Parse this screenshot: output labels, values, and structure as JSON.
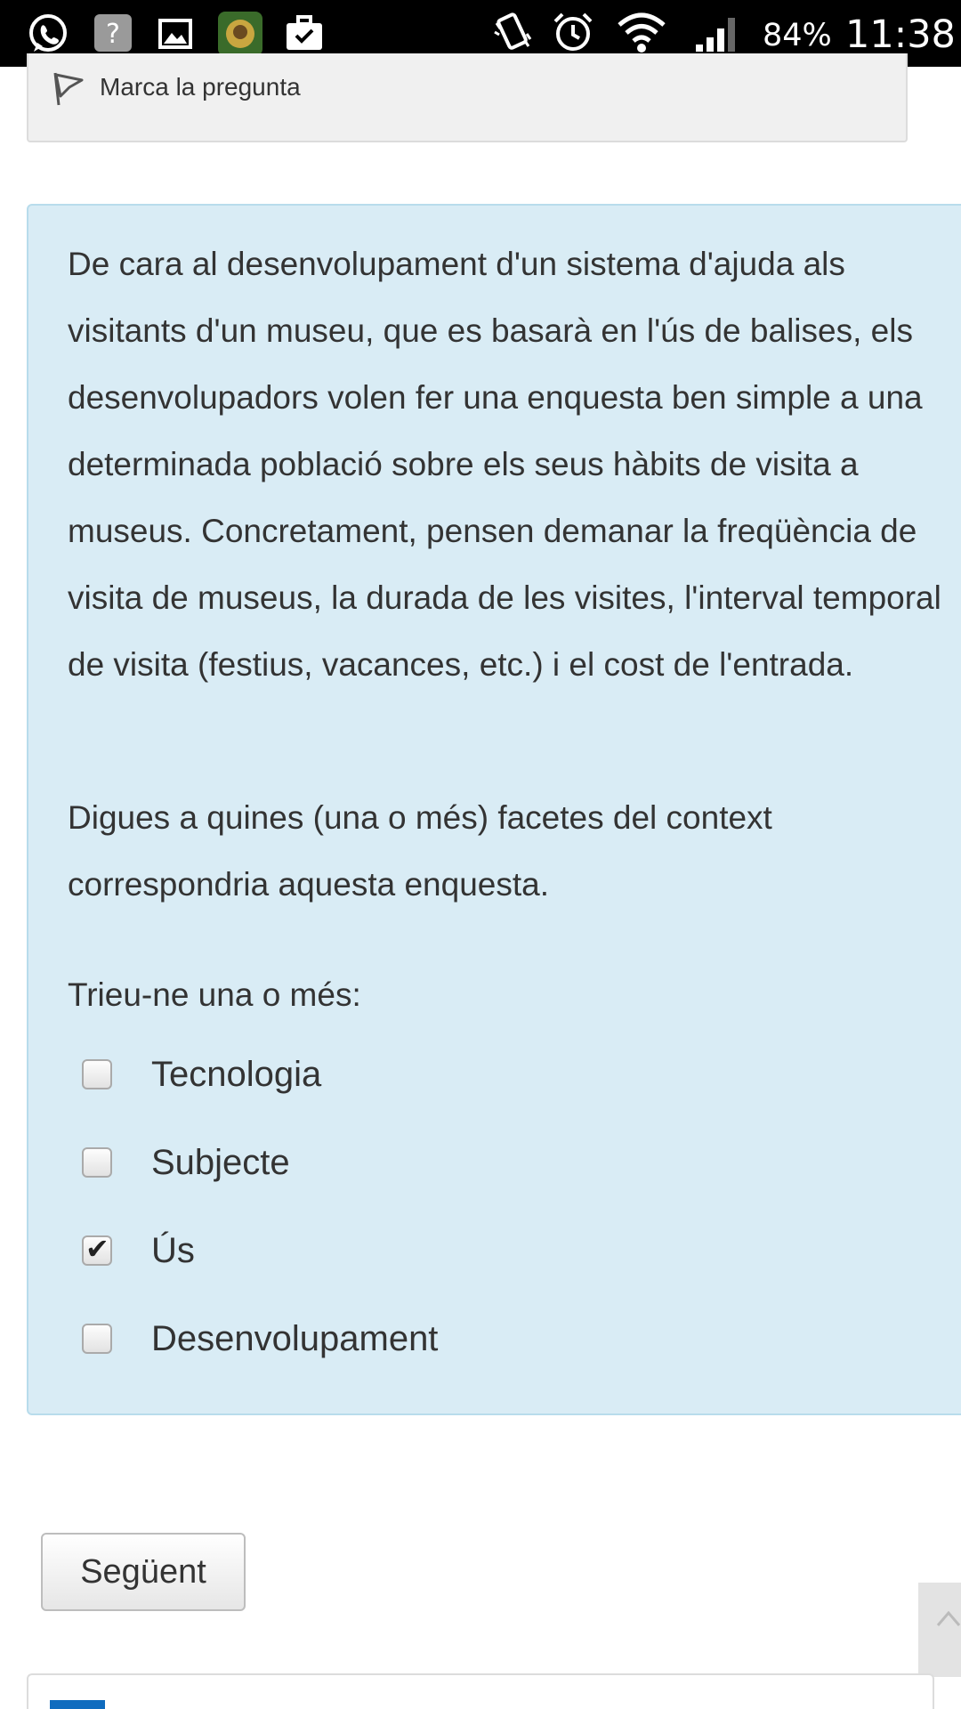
{
  "status_bar": {
    "icons": [
      "whatsapp-icon",
      "unknown-app-icon",
      "gallery-icon",
      "game-icon",
      "briefcase-check-icon",
      "vibrate-icon",
      "alarm-icon",
      "wifi-icon",
      "signal-icon"
    ],
    "battery": "84%",
    "time": "11:38"
  },
  "flag": {
    "label": "Marca la pregunta"
  },
  "question": {
    "text": "De cara al desenvolupament d'un sistema d'ajuda als visitants d'un museu, que es basarà en l'ús de balises, els desenvolupadors volen fer una enquesta ben simple a una determinada població sobre els seus hàbits de visita a museus. Concretament, pensen demanar la freqüència de visita de museus, la durada de les visites, l'interval temporal de visita (festius, vacances, etc.) i el cost de l'entrada.",
    "prompt": "Digues a quines (una o més)  facetes del context correspondria aquesta enquesta.",
    "choose_label": "Trieu-ne una o més:",
    "options": [
      {
        "label": "Tecnologia",
        "checked": false
      },
      {
        "label": "Subjecte",
        "checked": false
      },
      {
        "label": "Ús",
        "checked": true
      },
      {
        "label": "Desenvolupament",
        "checked": false
      }
    ]
  },
  "next_button": {
    "label": "Següent"
  },
  "colors": {
    "question_bg": "#d9ecf5",
    "question_border": "#b8dcec",
    "flag_bg": "#f0f0f0",
    "accent": "#0f6cbf"
  }
}
